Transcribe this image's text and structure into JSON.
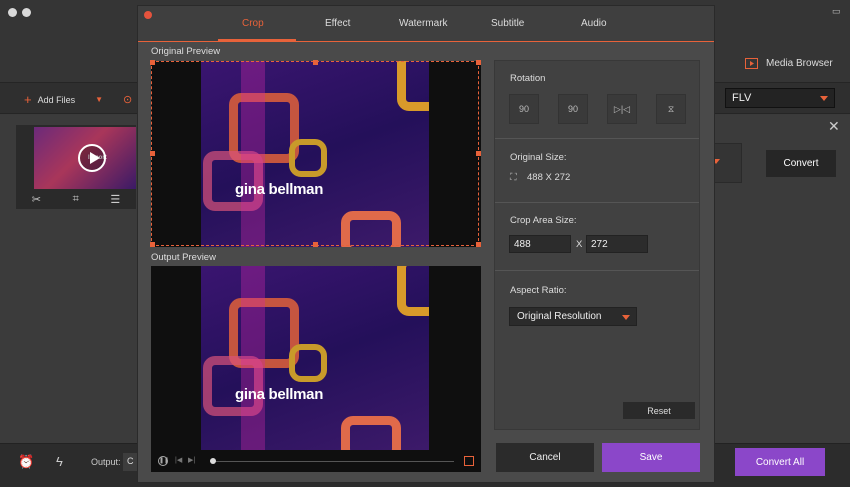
{
  "app": {
    "media_browser": "Media Browser",
    "add_files": "Add Files",
    "format": "FLV",
    "thumb_text": "Import",
    "convert": "Convert",
    "output_label": "Output:",
    "output_value": "C",
    "convert_all": "Convert All"
  },
  "dialog": {
    "tabs": [
      {
        "label": "Crop",
        "active": true
      },
      {
        "label": "Effect",
        "active": false
      },
      {
        "label": "Watermark",
        "active": false
      },
      {
        "label": "Subtitle",
        "active": false
      },
      {
        "label": "Audio",
        "active": false
      }
    ],
    "original_preview": "Original Preview",
    "output_preview": "Output Preview",
    "video_caption": "gina bellman",
    "rotation": {
      "title": "Rotation",
      "buttons": [
        {
          "icon": "rotate-left-icon",
          "text": "90"
        },
        {
          "icon": "rotate-right-icon",
          "text": "90"
        },
        {
          "icon": "flip-horizontal-icon",
          "text": ""
        },
        {
          "icon": "flip-vertical-icon",
          "text": ""
        }
      ]
    },
    "original_size": {
      "title": "Original Size:",
      "value": "488 X 272"
    },
    "crop_area": {
      "title": "Crop Area Size:",
      "width": "488",
      "separator": "X",
      "height": "272"
    },
    "aspect_ratio": {
      "title": "Aspect Ratio:",
      "value": "Original Resolution"
    },
    "reset": "Reset",
    "cancel": "Cancel",
    "save": "Save"
  },
  "colors": {
    "accent": "#e8623a",
    "purple": "#8b47c9"
  }
}
